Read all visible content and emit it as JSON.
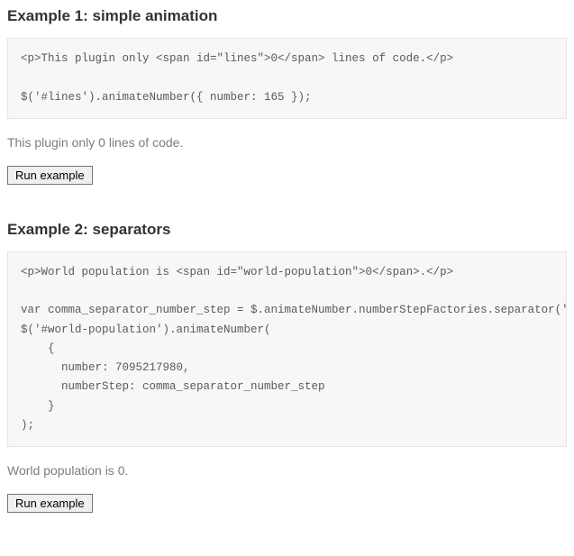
{
  "sections": [
    {
      "heading": "Example 1: simple animation",
      "code": "<p>This plugin only <span id=\"lines\">0</span> lines of code.</p>\n\n$('#lines').animateNumber({ number: 165 });",
      "demo_text": "This plugin only 0 lines of code.",
      "button_label": "Run example"
    },
    {
      "heading": "Example 2: separators",
      "code": "<p>World population is <span id=\"world-population\">0</span>.</p>\n\nvar comma_separator_number_step = $.animateNumber.numberStepFactories.separator(',')\n$('#world-population').animateNumber(\n    {\n      number: 7095217980,\n      numberStep: comma_separator_number_step\n    }\n);",
      "demo_text": "World population is 0.",
      "button_label": "Run example"
    }
  ]
}
